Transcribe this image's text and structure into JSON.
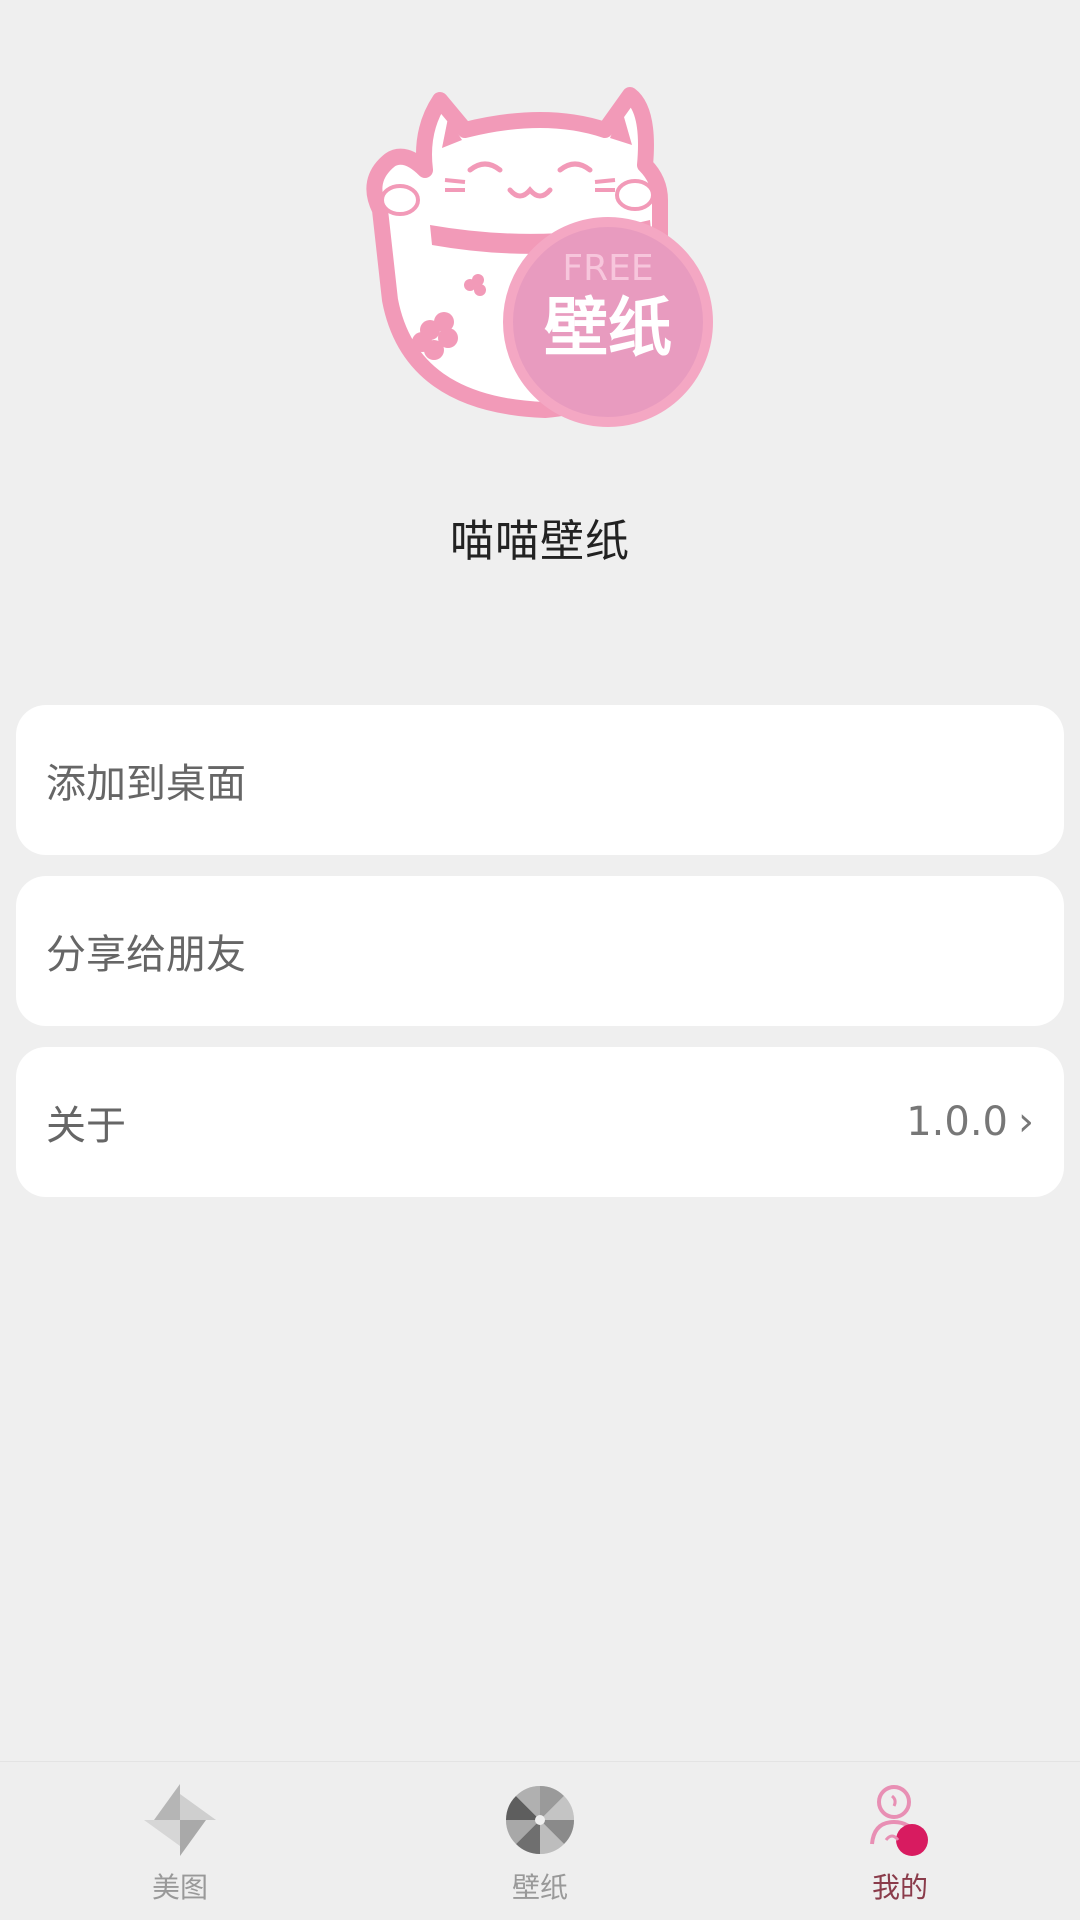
{
  "app": {
    "name": "喵喵壁纸",
    "logo": {
      "badge_top": "FREE",
      "badge_main": "壁纸",
      "colors": {
        "pink": "#f29ab8",
        "badge": "#e89bbf",
        "badge_border": "#f4a7c3"
      }
    }
  },
  "menu": {
    "items": [
      {
        "label": "添加到桌面"
      },
      {
        "label": "分享给朋友"
      },
      {
        "label": "关于",
        "value": "1.0.0",
        "icon": "chevron-right-icon"
      }
    ]
  },
  "tabbar": {
    "tabs": [
      {
        "label": "美图",
        "icon": "pinwheel-icon",
        "active": false
      },
      {
        "label": "壁纸",
        "icon": "aperture-icon",
        "active": false
      },
      {
        "label": "我的",
        "icon": "profile-icon",
        "active": true
      }
    ],
    "active_color": "#8a3b4a",
    "inactive_color": "#999999"
  }
}
